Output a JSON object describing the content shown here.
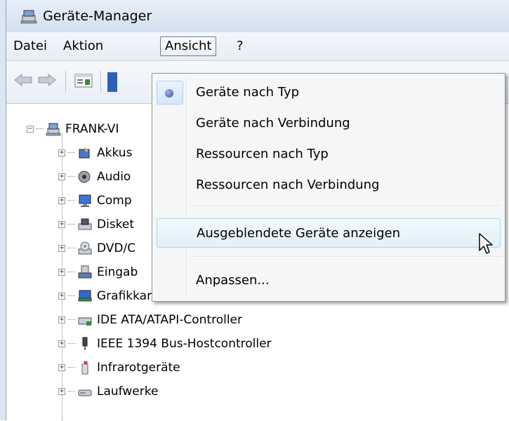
{
  "window": {
    "title": "Geräte-Manager"
  },
  "menubar": {
    "items": [
      "Datei",
      "Aktion",
      "Ansicht",
      "?"
    ]
  },
  "ansicht_menu": {
    "items": [
      {
        "label": "Geräte nach Typ",
        "checked": true
      },
      {
        "label": "Geräte nach Verbindung",
        "checked": false
      },
      {
        "label": "Ressourcen nach Typ",
        "checked": false
      },
      {
        "label": "Ressourcen nach Verbindung",
        "checked": false
      },
      {
        "label": "Ausgeblendete Geräte anzeigen",
        "checked": false,
        "hovered": true
      },
      {
        "label": "Anpassen...",
        "checked": false
      }
    ]
  },
  "tree": {
    "root": "FRANK-VI",
    "nodes": [
      "Akkus",
      "Audio",
      "Comp",
      "Disket",
      "DVD/C",
      "Eingab",
      "Grafikkarte",
      "IDE ATA/ATAPI-Controller",
      "IEEE 1394 Bus-Hostcontroller",
      "Infrarotgeräte",
      "Laufwerke"
    ]
  },
  "colors": {
    "accent": "#3953a6",
    "menu_hover_border": "#a8d8eb",
    "frame": "#dbe6f2"
  }
}
